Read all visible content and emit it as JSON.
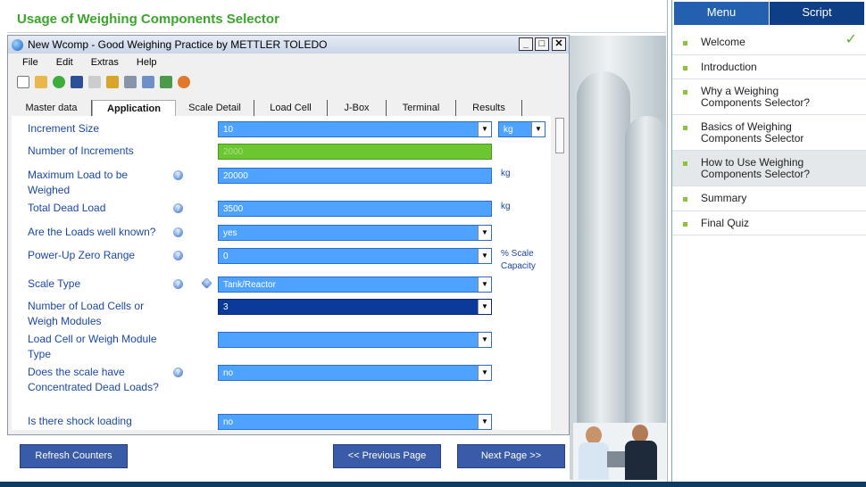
{
  "page_title": "Usage of Weighing Components Selector",
  "window": {
    "title": "New Wcomp - Good Weighing Practice by METTLER TOLEDO",
    "menu": [
      "File",
      "Edit",
      "Extras",
      "Help"
    ],
    "tabs": [
      "Master data",
      "Application",
      "Scale Detail",
      "Load Cell",
      "J-Box",
      "Terminal",
      "Results"
    ]
  },
  "form": {
    "increment_size": {
      "label": "Increment Size",
      "value": "10",
      "unit": "kg"
    },
    "num_increments": {
      "label": "Number of Increments",
      "value": "2000"
    },
    "max_load": {
      "label": "Maximum Load to be Weighed",
      "value": "20000",
      "unit": "kg"
    },
    "dead_load": {
      "label": "Total Dead Load",
      "value": "3500",
      "unit": "kg"
    },
    "loads_known": {
      "label": "Are the Loads well known?",
      "value": "yes"
    },
    "zero_range": {
      "label": "Power-Up Zero Range",
      "value": "0",
      "unit": "% Scale Capacity"
    },
    "scale_type": {
      "label": "Scale Type",
      "value": "Tank/Reactor"
    },
    "num_cells": {
      "label": "Number of Load Cells or Weigh Modules",
      "value": "3"
    },
    "cell_type": {
      "label": "Load Cell or Weigh Module Type",
      "value": ""
    },
    "concentrated": {
      "label": "Does the scale have Concentrated Dead Loads?",
      "value": "no"
    },
    "shock": {
      "label": "Is there shock loading",
      "value": "no"
    }
  },
  "buttons": {
    "refresh": "Refresh Counters",
    "prev": "<< Previous Page",
    "next": "Next Page >>"
  },
  "side_panel": {
    "tabs": [
      "Menu",
      "Script"
    ],
    "items": [
      {
        "label": "Welcome",
        "done": true
      },
      {
        "label": "Introduction"
      },
      {
        "label": "Why a Weighing Components Selector?"
      },
      {
        "label": "Basics of Weighing Components Selector"
      },
      {
        "label": "How to Use Weighing Components Selector?",
        "selected": true
      },
      {
        "label": "Summary"
      },
      {
        "label": "Final Quiz"
      }
    ]
  },
  "colors": {
    "accent_green": "#3aa62a",
    "field_blue": "#4da3ff",
    "field_dark": "#0a3a9a",
    "field_green": "#6cc62f",
    "nav_blue": "#3a5ba8"
  }
}
